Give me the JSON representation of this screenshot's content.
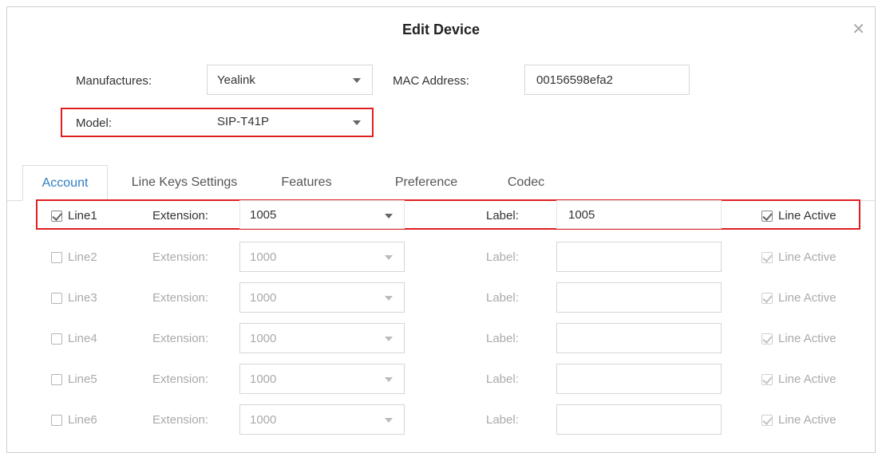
{
  "dialog": {
    "title": "Edit Device",
    "close_icon": "close-icon"
  },
  "form": {
    "manufactures_label": "Manufactures:",
    "manufactures_value": "Yealink",
    "mac_label": "MAC Address:",
    "mac_value": "00156598efa2",
    "model_label": "Model:",
    "model_value": "SIP-T41P"
  },
  "tabs": [
    {
      "label": "Account",
      "active": true
    },
    {
      "label": "Line Keys Settings",
      "active": false
    },
    {
      "label": "Features",
      "active": false
    },
    {
      "label": "Preference",
      "active": false
    },
    {
      "label": "Codec",
      "active": false
    }
  ],
  "lines": [
    {
      "label": "Line1",
      "checked": true,
      "extension_label": "Extension:",
      "extension": "1005",
      "label_label": "Label:",
      "label_value": "1005",
      "line_active_label": "Line Active",
      "line_active": true
    },
    {
      "label": "Line2",
      "checked": false,
      "extension_label": "Extension:",
      "extension": "1000",
      "label_label": "Label:",
      "label_value": "",
      "line_active_label": "Line Active",
      "line_active": true
    },
    {
      "label": "Line3",
      "checked": false,
      "extension_label": "Extension:",
      "extension": "1000",
      "label_label": "Label:",
      "label_value": "",
      "line_active_label": "Line Active",
      "line_active": true
    },
    {
      "label": "Line4",
      "checked": false,
      "extension_label": "Extension:",
      "extension": "1000",
      "label_label": "Label:",
      "label_value": "",
      "line_active_label": "Line Active",
      "line_active": true
    },
    {
      "label": "Line5",
      "checked": false,
      "extension_label": "Extension:",
      "extension": "1000",
      "label_label": "Label:",
      "label_value": "",
      "line_active_label": "Line Active",
      "line_active": true
    },
    {
      "label": "Line6",
      "checked": false,
      "extension_label": "Extension:",
      "extension": "1000",
      "label_label": "Label:",
      "label_value": "",
      "line_active_label": "Line Active",
      "line_active": true
    }
  ],
  "colors": {
    "accent": "#2f7fc1",
    "highlight": "#e02020",
    "disabled_text": "#aaaaaa"
  }
}
